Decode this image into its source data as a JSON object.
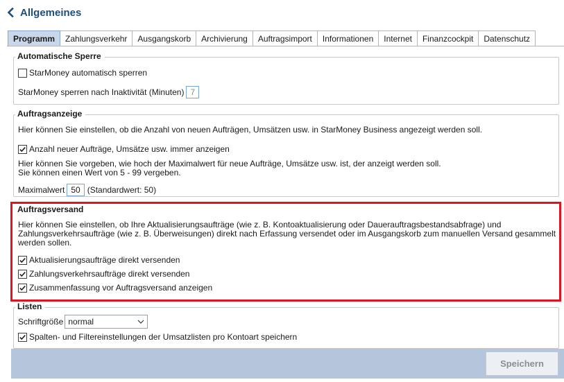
{
  "header": {
    "title": "Allgemeines",
    "back_icon": "chevron-left-icon"
  },
  "tabs": [
    {
      "label": "Programm",
      "active": true
    },
    {
      "label": "Zahlungsverkehr"
    },
    {
      "label": "Ausgangskorb"
    },
    {
      "label": "Archivierung"
    },
    {
      "label": "Auftragsimport"
    },
    {
      "label": "Informationen"
    },
    {
      "label": "Internet"
    },
    {
      "label": "Finanzcockpit"
    },
    {
      "label": "Datenschutz"
    }
  ],
  "sperre": {
    "legend": "Automatische Sperre",
    "checkbox_label": "StarMoney automatisch sperren",
    "checked": false,
    "inactivity_label": "StarMoney sperren nach Inaktivität (Minuten)",
    "inactivity_value": "7"
  },
  "anzeige": {
    "legend": "Auftragsanzeige",
    "intro": "Hier können Sie einstellen, ob die Anzahl von neuen Aufträgen, Umsätzen usw. in StarMoney Business angezeigt werden soll.",
    "checkbox_label": "Anzahl neuer Aufträge, Umsätze usw. immer anzeigen",
    "checked": true,
    "max_text_line1": "Hier können Sie vorgeben, wie hoch der Maximalwert für neue Aufträge, Umsätze usw. ist, der anzeigt werden soll.",
    "max_text_line2": "Sie können einen Wert von 5 - 99 vergeben.",
    "max_label": "Maximalwert",
    "max_value": "50",
    "max_default": "(Standardwert: 50)"
  },
  "versand": {
    "legend": "Auftragsversand",
    "intro_line1": "Hier können Sie einstellen, ob Ihre Aktualisierungsaufträge (wie z. B. Kontoaktualisierung oder Dauerauftragsbestandsabfrage) und",
    "intro_line2": "Zahlungsverkehrsaufträge (wie z. B. Überweisungen) direkt nach Erfassung versendet oder im Ausgangskorb zum manuellen Versand gesammelt",
    "intro_line3": "werden sollen.",
    "options": [
      {
        "label": "Aktualisierungsaufträge direkt versenden",
        "checked": true
      },
      {
        "label": "Zahlungsverkehrsaufträge direkt versenden",
        "checked": true
      },
      {
        "label": "Zusammenfassung vor Auftragsversand anzeigen",
        "checked": true
      }
    ],
    "highlight_color": "#e0141e"
  },
  "listen": {
    "legend": "Listen",
    "font_size_label": "Schriftgröße",
    "font_size_value": "normal",
    "checkbox_label": "Spalten- und Filtereinstellungen der Umsatzlisten pro Kontoart speichern",
    "checked": true
  },
  "footer": {
    "save_label": "Speichern",
    "save_enabled": false
  },
  "colors": {
    "accent": "#1f4e79",
    "active_tab": "#c9d7ea",
    "footer_bar": "#b4c5dc"
  }
}
